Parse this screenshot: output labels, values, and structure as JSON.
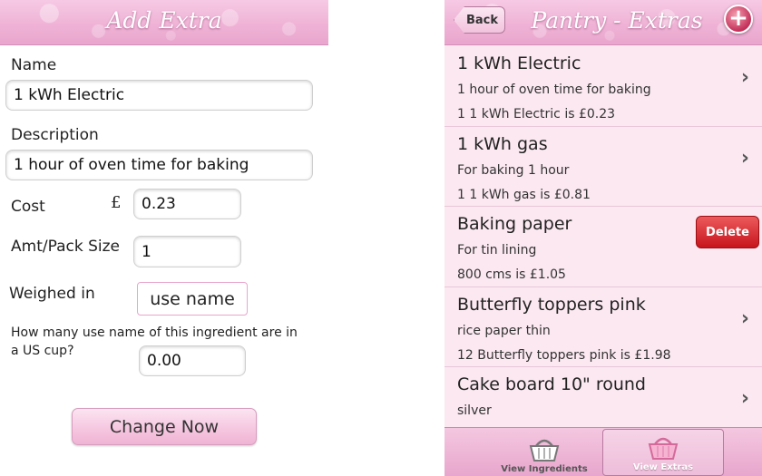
{
  "left_screen": {
    "title": "Add Extra",
    "name_label": "Name",
    "name_value": "1 kWh Electric",
    "description_label": "Description",
    "description_value": "1 hour of oven time for baking",
    "cost_label": "Cost",
    "currency_symbol": "£",
    "cost_value": "0.23",
    "amt_label": "Amt/Pack Size",
    "amt_value": "1",
    "weighed_label": "Weighed in",
    "weighed_value": "use name",
    "cup_question": "How many use name of this ingredient are in a US cup?",
    "cup_value": "0.00",
    "change_button": "Change Now"
  },
  "right_screen": {
    "title": "Pantry - Extras",
    "back_button": "Back",
    "add_button": "+",
    "items": [
      {
        "title": "1 kWh Electric",
        "desc": "1 hour of oven time for baking",
        "price": "1 1 kWh Electric is £0.23"
      },
      {
        "title": "1 kWh gas",
        "desc": "For baking 1 hour",
        "price": "1 1 kWh gas is £0.81"
      },
      {
        "title": "Baking paper",
        "desc": "For tin lining",
        "price": "800 cms is £1.05",
        "delete_label": "Delete"
      },
      {
        "title": "Butterfly toppers pink",
        "desc": "rice paper thin",
        "price": "12 Butterfly toppers pink is £1.98"
      },
      {
        "title": "Cake board 10\" round",
        "desc": "silver",
        "price": ""
      }
    ],
    "tabs": [
      {
        "label": "View Ingredients",
        "icon": "basket-icon"
      },
      {
        "label": "View Extras",
        "icon": "basket-icon",
        "active": true
      }
    ]
  },
  "colors": {
    "navbar_pink": "#efb3d6",
    "list_background": "#fbe8f1",
    "delete_red": "#d3262b",
    "add_button_red": "#c3305a"
  }
}
